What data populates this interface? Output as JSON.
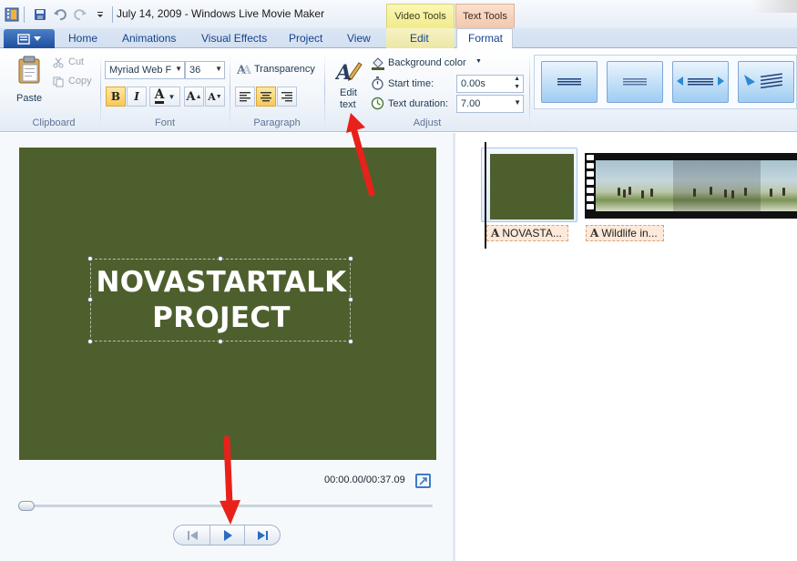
{
  "window": {
    "title": "July 14, 2009 - Windows Live Movie Maker"
  },
  "context_tabs": {
    "video_tools": "Video Tools",
    "text_tools": "Text Tools"
  },
  "tabs": [
    "Home",
    "Animations",
    "Visual Effects",
    "Project",
    "View",
    "Edit",
    "Format"
  ],
  "ribbon": {
    "clipboard": {
      "paste": "Paste",
      "cut": "Cut",
      "copy": "Copy",
      "label": "Clipboard"
    },
    "font": {
      "family": "Myriad Web F",
      "size": "36",
      "bold": "B",
      "italic": "I",
      "color": "A",
      "grow": "A",
      "shrink": "A",
      "label": "Font"
    },
    "paragraph": {
      "transparency": "Transparency",
      "label": "Paragraph"
    },
    "adjust": {
      "edit_text_line1": "Edit",
      "edit_text_line2": "text",
      "background_color": "Background color",
      "start_time_label": "Start time:",
      "start_time_value": "0.00s",
      "text_duration_label": "Text duration:",
      "text_duration_value": "7.00",
      "label": "Adjust"
    }
  },
  "preview": {
    "caption_line1": "NOVASTARTALK",
    "caption_line2": "PROJECT",
    "timecode": "00:00.00/00:37.09",
    "background_color": "#4e5f2e"
  },
  "storyboard": {
    "clips": [
      {
        "caption": "NOVASTA..."
      },
      {
        "caption": "Wildlife in..."
      }
    ]
  },
  "colors": {
    "accent": "#1e4f9e",
    "annotation_arrow": "#e8211a",
    "caption_chip": "#fde9d9"
  }
}
